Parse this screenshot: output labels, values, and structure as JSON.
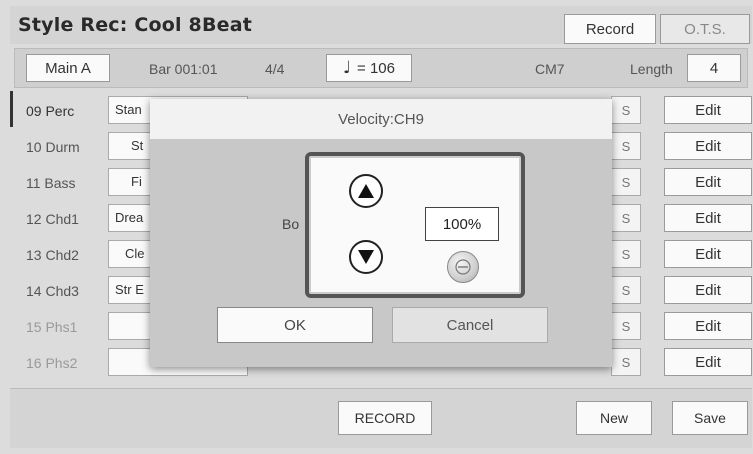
{
  "title": "Style Rec: Cool 8Beat",
  "tabs": {
    "record": "Record",
    "ots": "O.T.S."
  },
  "info": {
    "section": "Main A",
    "bar": "Bar 001:01",
    "time_sig": "4/4",
    "tempo": "= 106",
    "tempo_icon": "quarter-note-icon",
    "chord": "CM7",
    "length_label": "Length",
    "length_value": "4"
  },
  "tracks": [
    {
      "name": "09 Perc",
      "voice": "Stan",
      "s": "S",
      "edit": "Edit"
    },
    {
      "name": "10 Durm",
      "voice": "St",
      "s": "S",
      "edit": "Edit"
    },
    {
      "name": "11 Bass",
      "voice": "Fi",
      "s": "S",
      "edit": "Edit"
    },
    {
      "name": "12 Chd1",
      "voice": "Drea",
      "s": "S",
      "edit": "Edit"
    },
    {
      "name": "13 Chd2",
      "voice": "Cle",
      "s": "S",
      "edit": "Edit"
    },
    {
      "name": "14 Chd3",
      "voice": "Str E",
      "s": "S",
      "edit": "Edit"
    },
    {
      "name": "15 Phs1",
      "voice": "",
      "s": "S",
      "edit": "Edit"
    },
    {
      "name": "16 Phs2",
      "voice": "",
      "s": "S",
      "edit": "Edit"
    }
  ],
  "bottom": {
    "record": "RECORD",
    "new": "New",
    "save": "Save"
  },
  "dialog": {
    "title": "Velocity:CH9",
    "label_partial": "Bo",
    "value": "100%",
    "up_icon": "up-arrow-icon",
    "down_icon": "down-arrow-icon",
    "knob_icon": "knob-icon",
    "ok": "OK",
    "cancel": "Cancel"
  },
  "colors": {
    "background": "#dcdcdc",
    "panel_border": "#555555",
    "selection_bar": "#333333"
  }
}
